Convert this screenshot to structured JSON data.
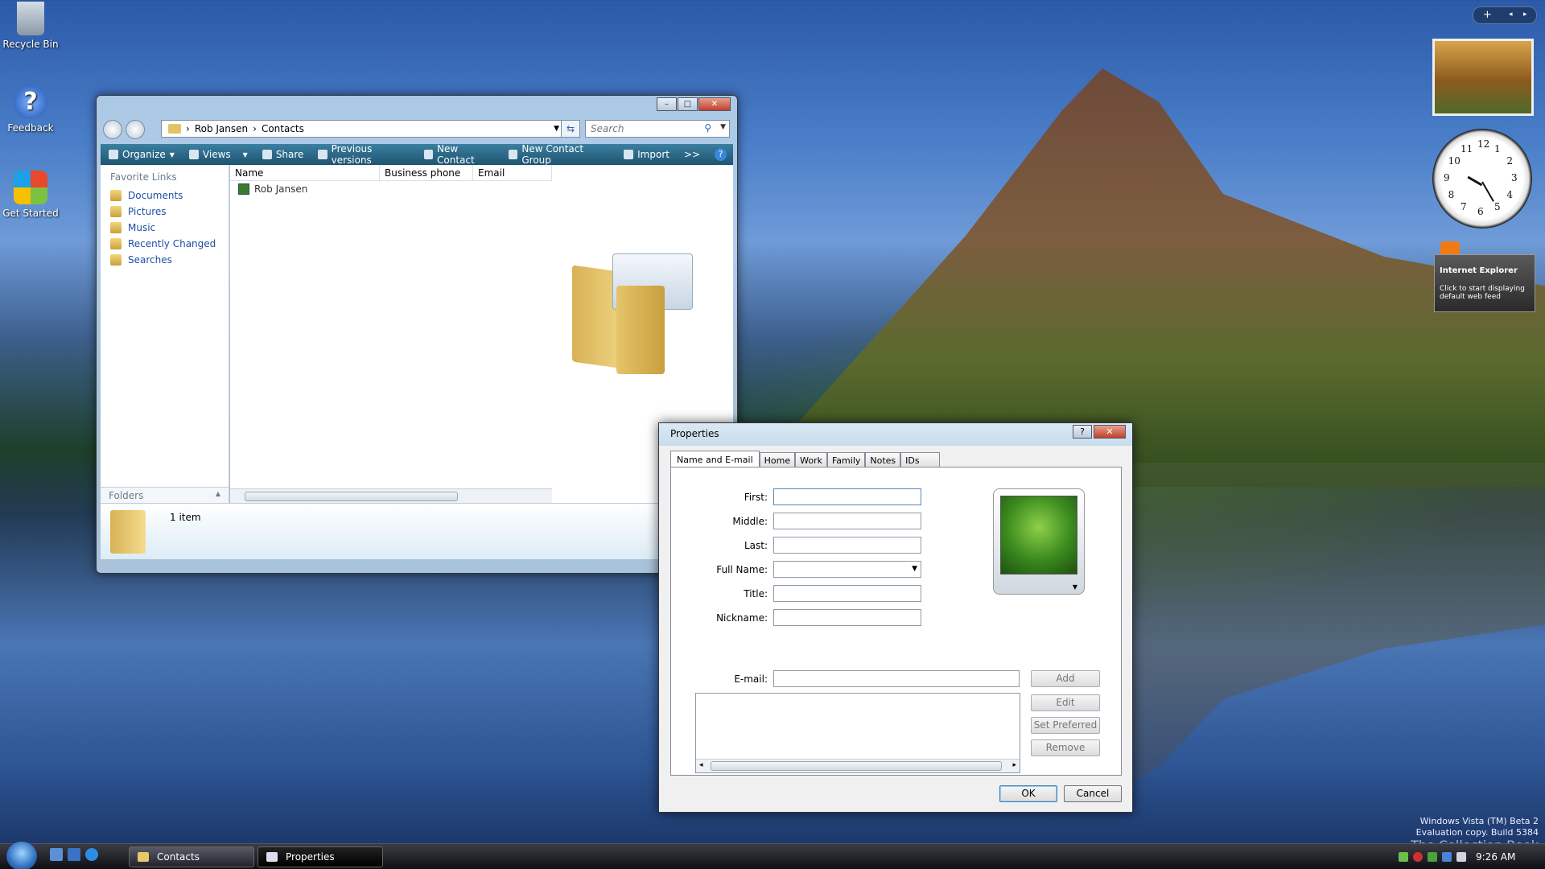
{
  "desktop": {
    "icons": [
      {
        "label": "Recycle Bin"
      },
      {
        "label": "Feedback"
      },
      {
        "label": "Get Started"
      }
    ]
  },
  "explorer": {
    "breadcrumb": [
      "Rob Jansen",
      "Contacts"
    ],
    "search_placeholder": "Search",
    "toolbar": {
      "organize": "Organize",
      "views": "Views",
      "share": "Share",
      "previous_versions": "Previous versions",
      "new_contact": "New Contact",
      "new_contact_group": "New Contact Group",
      "import": "Import",
      "more": ">>",
      "help": "?"
    },
    "favorite_links": {
      "heading": "Favorite Links",
      "items": [
        "Documents",
        "Pictures",
        "Music",
        "Recently Changed",
        "Searches"
      ]
    },
    "folders_label": "Folders",
    "columns": [
      "Name",
      "Business phone",
      "Email"
    ],
    "rows": [
      {
        "name": "Rob Jansen",
        "phone": "",
        "email": ""
      }
    ],
    "details": {
      "item_count": "1 item"
    }
  },
  "properties": {
    "title": "Properties",
    "tabs": [
      "Name and E-mail",
      "Home",
      "Work",
      "Family",
      "Notes",
      "IDs"
    ],
    "active_tab": "Name and E-mail",
    "fields": {
      "first": "First:",
      "middle": "Middle:",
      "last": "Last:",
      "full_name": "Full Name:",
      "title": "Title:",
      "nickname": "Nickname:",
      "email": "E-mail:"
    },
    "buttons": {
      "add": "Add",
      "edit": "Edit",
      "set_preferred": "Set Preferred",
      "remove": "Remove",
      "ok": "OK",
      "cancel": "Cancel"
    }
  },
  "sidebar": {
    "feed_title": "Internet Explorer",
    "feed_text": "Click to start displaying default web feed",
    "clock_numbers": [
      "12",
      "1",
      "2",
      "3",
      "4",
      "5",
      "6",
      "7",
      "8",
      "9",
      "10",
      "11"
    ]
  },
  "taskbar": {
    "tasks": [
      "Contacts",
      "Properties"
    ],
    "time": "9:26 AM"
  },
  "watermark": {
    "line1": "Windows Vista (TM) Beta 2",
    "line2": "Evaluation copy. Build 5384",
    "overlay": "The Collection Book"
  },
  "colors": {
    "toolbar": "#1e5470",
    "link": "#1b4fa0"
  }
}
